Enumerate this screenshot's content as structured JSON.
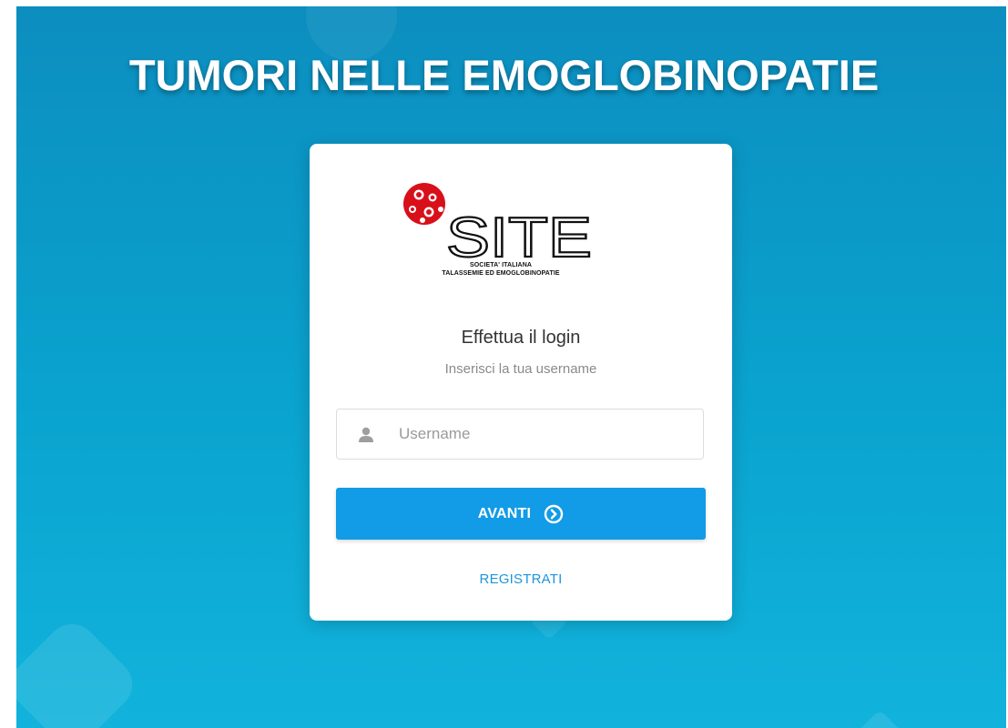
{
  "header": {
    "title": "TUMORI NELLE EMOGLOBINOPATIE"
  },
  "logo": {
    "wordmark": "SITE",
    "subtitle_line1": "SOCIETA' ITALIANA",
    "subtitle_line2": "TALASSEMIE ED EMOGLOBINOPATIE"
  },
  "login": {
    "heading": "Effettua il login",
    "subheading": "Inserisci la tua username",
    "username_placeholder": "Username",
    "username_value": "",
    "username_icon": "user-icon",
    "next_button_label": "AVANTI",
    "next_button_icon": "circle-chevron-right-icon",
    "register_link": "REGISTRATI"
  },
  "colors": {
    "background_top": "#0c8ebf",
    "background_bottom": "#11b3dc",
    "button": "#129be6",
    "link": "#1e95db",
    "logo_red": "#d8101a"
  }
}
